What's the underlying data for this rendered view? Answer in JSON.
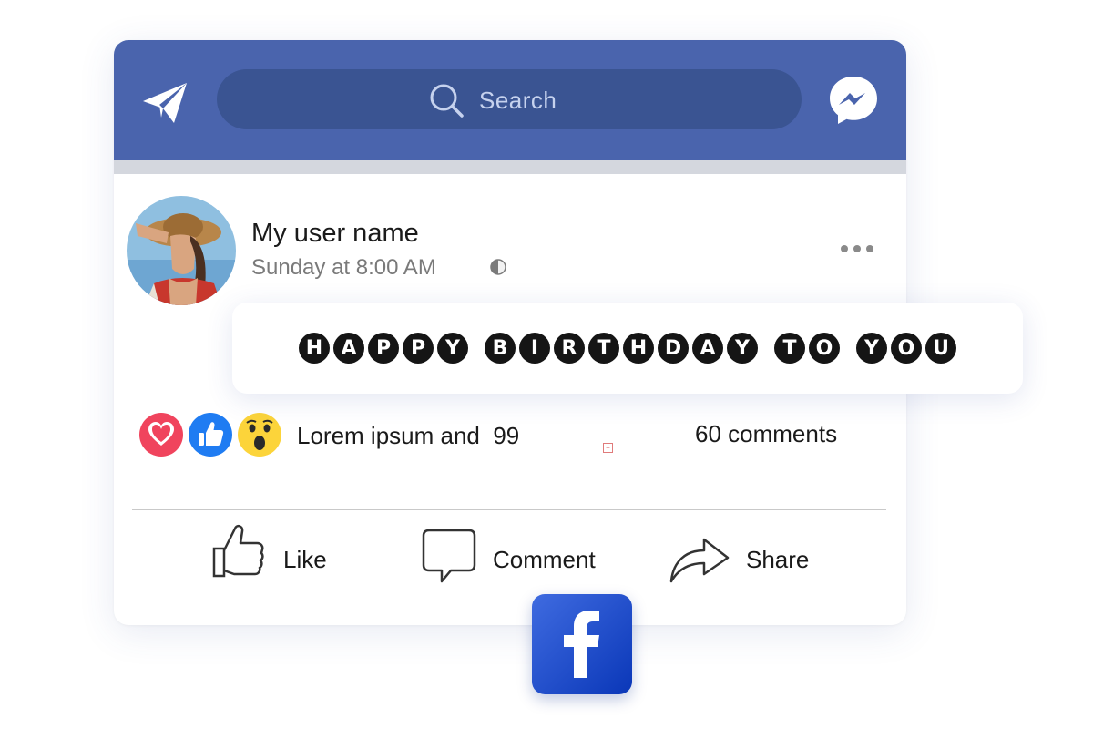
{
  "header": {
    "search_placeholder": "Search",
    "brand_color": "#4a64ad",
    "search_bg": "#3a5492",
    "icons": {
      "left": "send-icon",
      "search": "search-icon",
      "right": "messenger-icon"
    }
  },
  "post": {
    "username": "My user name",
    "time": "Sunday at 8:00 AM",
    "privacy_icon": "globe-icon",
    "menu_icon": "more-options-icon"
  },
  "banner": {
    "words": [
      [
        "H",
        "A",
        "P",
        "P",
        "Y"
      ],
      [
        "B",
        "I",
        "R",
        "T",
        "H",
        "D",
        "A",
        "Y"
      ],
      [
        "T",
        "O"
      ],
      [
        "Y",
        "O",
        "U"
      ]
    ]
  },
  "reactions": {
    "icons": [
      "love-reaction-icon",
      "like-reaction-icon",
      "wow-reaction-icon"
    ],
    "text": "Lorem ipsum and  99",
    "comments": "60 comments"
  },
  "actions": {
    "like": "Like",
    "comment": "Comment",
    "share": "Share"
  },
  "footer_logo": "facebook-logo"
}
